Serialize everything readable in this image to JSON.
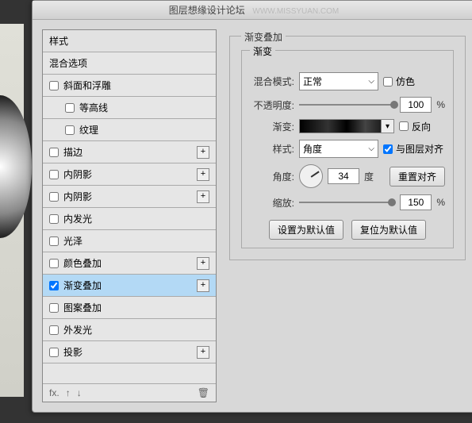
{
  "titlebar": {
    "text": "图层想缘设计论坛",
    "watermark": "WWW.MISSYUAN.COM"
  },
  "left": {
    "header": "样式",
    "blending": "混合选项",
    "items": [
      {
        "label": "斜面和浮雕",
        "plus": false,
        "sub": false
      },
      {
        "label": "等高线",
        "plus": false,
        "sub": true
      },
      {
        "label": "纹理",
        "plus": false,
        "sub": true
      },
      {
        "label": "描边",
        "plus": true,
        "sub": false
      },
      {
        "label": "内阴影",
        "plus": true,
        "sub": false
      },
      {
        "label": "内阴影",
        "plus": true,
        "sub": false
      },
      {
        "label": "内发光",
        "plus": false,
        "sub": false
      },
      {
        "label": "光泽",
        "plus": false,
        "sub": false
      },
      {
        "label": "颜色叠加",
        "plus": true,
        "sub": false
      },
      {
        "label": "渐变叠加",
        "plus": true,
        "sub": false,
        "checked": true,
        "selected": true
      },
      {
        "label": "图案叠加",
        "plus": false,
        "sub": false
      },
      {
        "label": "外发光",
        "plus": false,
        "sub": false
      },
      {
        "label": "投影",
        "plus": true,
        "sub": false
      }
    ],
    "footer": {
      "fx": "fx",
      "trash": "🗑"
    }
  },
  "right": {
    "group_title": "渐变叠加",
    "sub_title": "渐变",
    "blendmode_label": "混合模式:",
    "blendmode_value": "正常",
    "dither_label": "仿色",
    "opacity_label": "不透明度:",
    "opacity_value": "100",
    "gradient_label": "渐变:",
    "reverse_label": "反向",
    "style_label": "样式:",
    "style_value": "角度",
    "align_label": "与图层对齐",
    "align_checked": true,
    "angle_label": "角度:",
    "angle_value": "34",
    "angle_unit": "度",
    "reset_align": "重置对齐",
    "scale_label": "缩放:",
    "scale_value": "150",
    "percent": "%",
    "make_default": "设置为默认值",
    "reset_default": "复位为默认值"
  }
}
